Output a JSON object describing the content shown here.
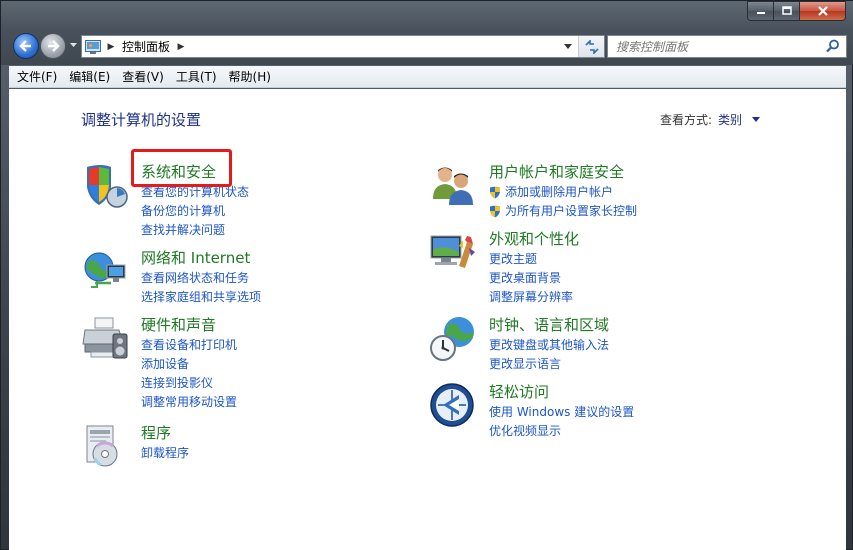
{
  "window": {
    "breadcrumb": "控制面板",
    "search_placeholder": "搜索控制面板"
  },
  "menu": [
    {
      "label": "文件(F)"
    },
    {
      "label": "编辑(E)"
    },
    {
      "label": "查看(V)"
    },
    {
      "label": "工具(T)"
    },
    {
      "label": "帮助(H)"
    }
  ],
  "content": {
    "heading": "调整计算机的设置",
    "view_by_label": "查看方式:",
    "view_by_value": "类别"
  },
  "categories": {
    "system": {
      "icon": "system-security-icon",
      "title": "系统和安全",
      "links": [
        "查看您的计算机状态",
        "备份您的计算机",
        "查找并解决问题"
      ]
    },
    "network": {
      "icon": "network-internet-icon",
      "title": "网络和 Internet",
      "links": [
        "查看网络状态和任务",
        "选择家庭组和共享选项"
      ]
    },
    "hardware": {
      "icon": "hardware-sound-icon",
      "title": "硬件和声音",
      "links": [
        "查看设备和打印机",
        "添加设备",
        "连接到投影仪",
        "调整常用移动设置"
      ]
    },
    "programs": {
      "icon": "programs-icon",
      "title": "程序",
      "links": [
        "卸载程序"
      ]
    },
    "users": {
      "icon": "user-accounts-icon",
      "title": "用户帐户和家庭安全",
      "links": [
        "添加或删除用户帐户",
        "为所有用户设置家长控制"
      ]
    },
    "appearance": {
      "icon": "appearance-icon",
      "title": "外观和个性化",
      "links": [
        "更改主题",
        "更改桌面背景",
        "调整屏幕分辨率"
      ]
    },
    "clock": {
      "icon": "clock-region-icon",
      "title": "时钟、语言和区域",
      "links": [
        "更改键盘或其他输入法",
        "更改显示语言"
      ]
    },
    "access": {
      "icon": "ease-of-access-icon",
      "title": "轻松访问",
      "links": [
        "使用 Windows 建议的设置",
        "优化视频显示"
      ]
    }
  },
  "colors": {
    "category_title": "#1e7a23",
    "link": "#1e56c8",
    "heading": "#1e3287",
    "highlight": "#e31b1b"
  }
}
